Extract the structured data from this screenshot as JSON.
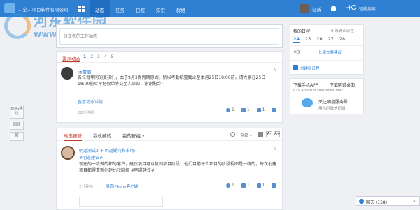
{
  "topbar": {
    "company": "…全…项目软件有限公司",
    "nav": [
      "动态",
      "任务",
      "日程",
      "知识",
      "群组"
    ],
    "user_name": "江新",
    "search_placeholder": "智能搜索..."
  },
  "watermark": {
    "title": "河东软件园",
    "url": "www.pc0359.cn"
  },
  "postbox": {
    "placeholder": "分享你的工作动态"
  },
  "top_post": {
    "tab_label": "置顶动态",
    "pages": [
      "1",
      "2",
      "3",
      "4",
      "5"
    ],
    "current_page": "1",
    "author": "汤蕾丽:",
    "body": "各位每年同的复核们，由于9月3周假期原因，所以考勤统整截止至本月25日18:00前，请大家在25日18:00前尽早把假单等交至人事部，谢谢配合~",
    "link": "查看动态详情",
    "time": "28分钟前",
    "actions": {
      "comment": "1",
      "attach": "1",
      "like": "1"
    }
  },
  "feed": {
    "tabs": [
      "动态更新",
      "我收藏的",
      "我的群组"
    ],
    "all": "全部",
    "font_small": "A-",
    "font_large": "A+",
    "post": {
      "line1": "明道测试2 + 明道疑问和市场:",
      "line2": "#明道建议#",
      "body": "现在的一款做的都的客户，建议项目可以复制项目阶段，他们目前每个项目的阶段视图是一样的，每次创建项目都得重新创建比较麻烦 #明道建议#",
      "time": "2分钟前",
      "source": "明道iPhone客户端",
      "actions": {
        "comment": "1",
        "attach": "1",
        "like": "1"
      }
    }
  },
  "side_feedback": [
    "BUG建议",
    "回顾",
    "帮"
  ],
  "schedule": {
    "title": "我的日程",
    "status": "0 未确认日程",
    "days": [
      "24",
      "25",
      "26",
      "27",
      "28"
    ],
    "current_day": "24",
    "allday": "全天",
    "share": "长尾文章建议",
    "new": "创建新日程"
  },
  "download": {
    "mobile": "下载手机APP",
    "desktop": "下载明道桌面",
    "platforms": "iOS  Android  Windows  Mac",
    "wechat_title": "关注明道服务号",
    "wechat_sub": "用你的微信扫描"
  },
  "chat": {
    "label": "聊天 (158)"
  }
}
